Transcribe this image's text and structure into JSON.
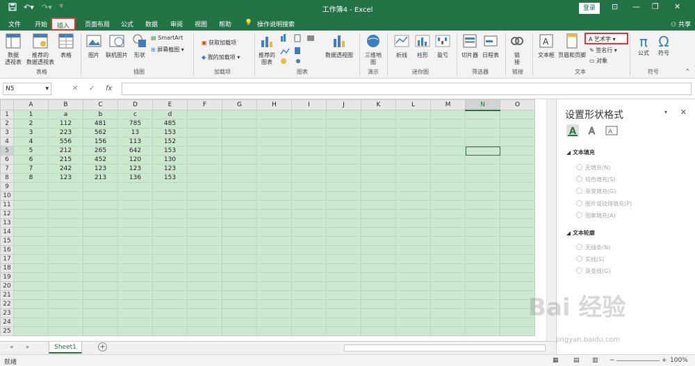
{
  "titlebar": {
    "title": "工作簿4 - Excel",
    "login": "登录",
    "save_icon": "save-icon",
    "undo_icon": "undo-icon",
    "redo_icon": "redo-icon"
  },
  "tabs": [
    "文件",
    "开始",
    "插入",
    "页面布局",
    "公式",
    "数据",
    "审阅",
    "视图",
    "帮助",
    "操作说明搜索"
  ],
  "active_tab": "插入",
  "share": "共享",
  "ribbon": {
    "groups": [
      "表格",
      "插图",
      "加载项",
      "图表",
      "演示",
      "迷你图",
      "筛选器",
      "链接",
      "文本",
      "符号"
    ],
    "pivot": "数据\n透视表",
    "rec_pivot": "推荐的\n数据透视表",
    "table": "表格",
    "picture": "图片",
    "online_picture": "联机图片",
    "shapes": "形状",
    "smartart": "SmartArt",
    "screenshot": "屏幕截图",
    "get_addins": "获取加载项",
    "my_addins": "我的加载项",
    "rec_charts": "推荐的\n图表",
    "pivot_chart": "数据透视图",
    "map3d": "三维地\n图",
    "line": "折线",
    "column": "柱形",
    "winloss": "盈亏",
    "slicer": "切片器",
    "timeline": "日程表",
    "link": "链\n接",
    "textbox": "文本框",
    "header_footer": "页眉和页脚",
    "wordart": "艺术字",
    "signature": "签名行",
    "object": "对象",
    "formula": "公式",
    "symbol": "符号",
    "pi": "π",
    "omega": "Ω"
  },
  "formula_bar": {
    "namebox": "N5",
    "fx": "fx",
    "value": ""
  },
  "grid": {
    "columns": [
      "A",
      "B",
      "C",
      "D",
      "E",
      "F",
      "G",
      "H",
      "I",
      "J",
      "K",
      "L",
      "M",
      "N",
      "O"
    ],
    "rows": [
      [
        "1",
        "a",
        "b",
        "c",
        "d"
      ],
      [
        "2",
        "112",
        "481",
        "785",
        "485"
      ],
      [
        "3",
        "223",
        "562",
        "13",
        "153"
      ],
      [
        "4",
        "556",
        "156",
        "113",
        "152"
      ],
      [
        "5",
        "212",
        "265",
        "642",
        "153"
      ],
      [
        "6",
        "215",
        "452",
        "120",
        "130"
      ],
      [
        "7",
        "242",
        "123",
        "123",
        "123"
      ],
      [
        "8",
        "123",
        "213",
        "136",
        "153"
      ]
    ],
    "row_count": 25,
    "selected": "N5"
  },
  "pane": {
    "title": "设置形状格式",
    "fill_section": "文本填充",
    "fill_options": [
      "无填充(N)",
      "纯色填充(S)",
      "渐变填充(G)",
      "图片或纹理填充(P)",
      "图案填充(A)"
    ],
    "outline_section": "文本轮廓",
    "outline_options": [
      "无线条(N)",
      "实线(S)",
      "渐变线(G)"
    ]
  },
  "sheet": {
    "tab": "Sheet1",
    "add": "+"
  },
  "status": {
    "ready": "就绪",
    "zoom": "100%"
  },
  "watermark": {
    "main": "Bai 经验",
    "sub": "jingyan.baidu.com"
  }
}
